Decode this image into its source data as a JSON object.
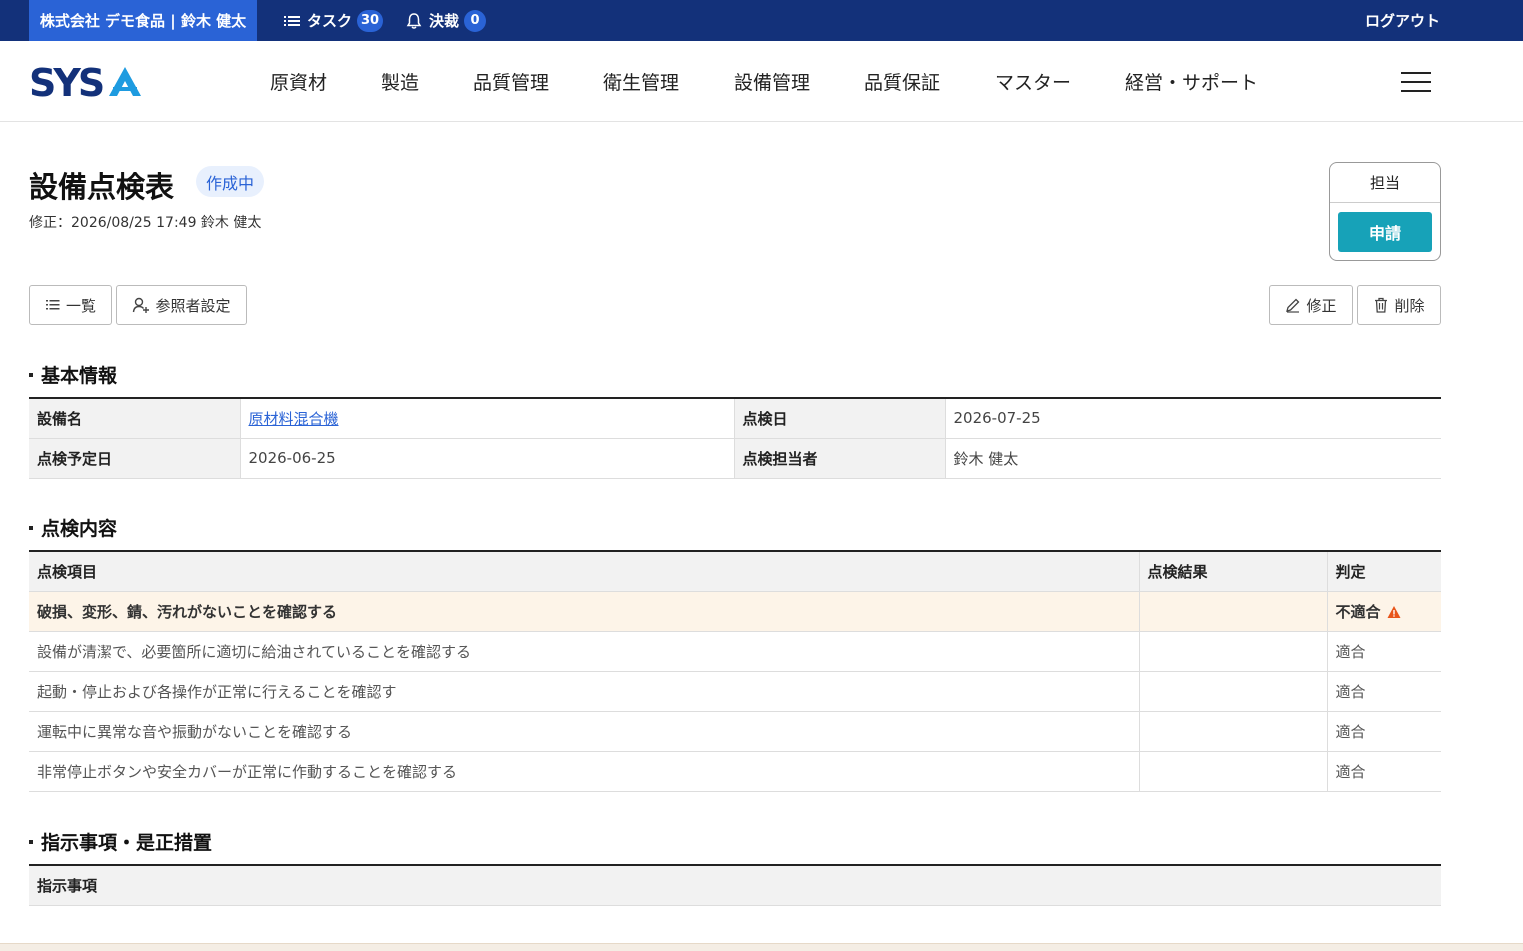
{
  "topbar": {
    "company_user": "株式会社 デモ食品 | 鈴木 健太",
    "task_label": "タスク",
    "task_count": "30",
    "approval_label": "決裁",
    "approval_count": "0",
    "logout": "ログアウト",
    "colors": {
      "bar": "#13317a",
      "accent": "#2a63d6"
    }
  },
  "nav": {
    "logo": "SYSA",
    "items": [
      "原資材",
      "製造",
      "品質管理",
      "衛生管理",
      "設備管理",
      "品質保証",
      "マスター",
      "経営・サポート"
    ],
    "menu_icon": "hamburger-icon"
  },
  "page": {
    "title": "設備点検表",
    "status": "作成中",
    "modified": "修正：2026/08/25 17:49 鈴木 健太"
  },
  "approval_box": {
    "role": "担当",
    "apply_button": "申請",
    "color": "#17a2b8"
  },
  "actions": {
    "list": "一覧",
    "viewer_settings": "参照者設定",
    "edit": "修正",
    "delete": "削除"
  },
  "basic_info": {
    "heading": "基本情報",
    "rows": [
      {
        "label1": "設備名",
        "value1": "原材料混合機",
        "label2": "点検日",
        "value2": "2026-07-25"
      },
      {
        "label1": "点検予定日",
        "value1": "2026-06-25",
        "label2": "点検担当者",
        "value2": "鈴木 健太"
      }
    ]
  },
  "inspection": {
    "heading": "点検内容",
    "columns": [
      "点検項目",
      "点検結果",
      "判定"
    ],
    "rows": [
      {
        "item": "破損、変形、錆、汚れがないことを確認する",
        "result": "",
        "judgement": "不適合"
      },
      {
        "item": "設備が清潔で、必要箇所に適切に給油されていることを確認する",
        "result": "",
        "judgement": "適合"
      },
      {
        "item": "起動・停止および各操作が正常に行えることを確認す",
        "result": "",
        "judgement": "適合"
      },
      {
        "item": "運転中に異常な音や振動がないことを確認する",
        "result": "",
        "judgement": "適合"
      },
      {
        "item": "非常停止ボタンや安全カバーが正常に作動することを確認する",
        "result": "",
        "judgement": "適合"
      }
    ]
  },
  "instructions": {
    "heading": "指示事項・是正措置",
    "column": "指示事項"
  }
}
